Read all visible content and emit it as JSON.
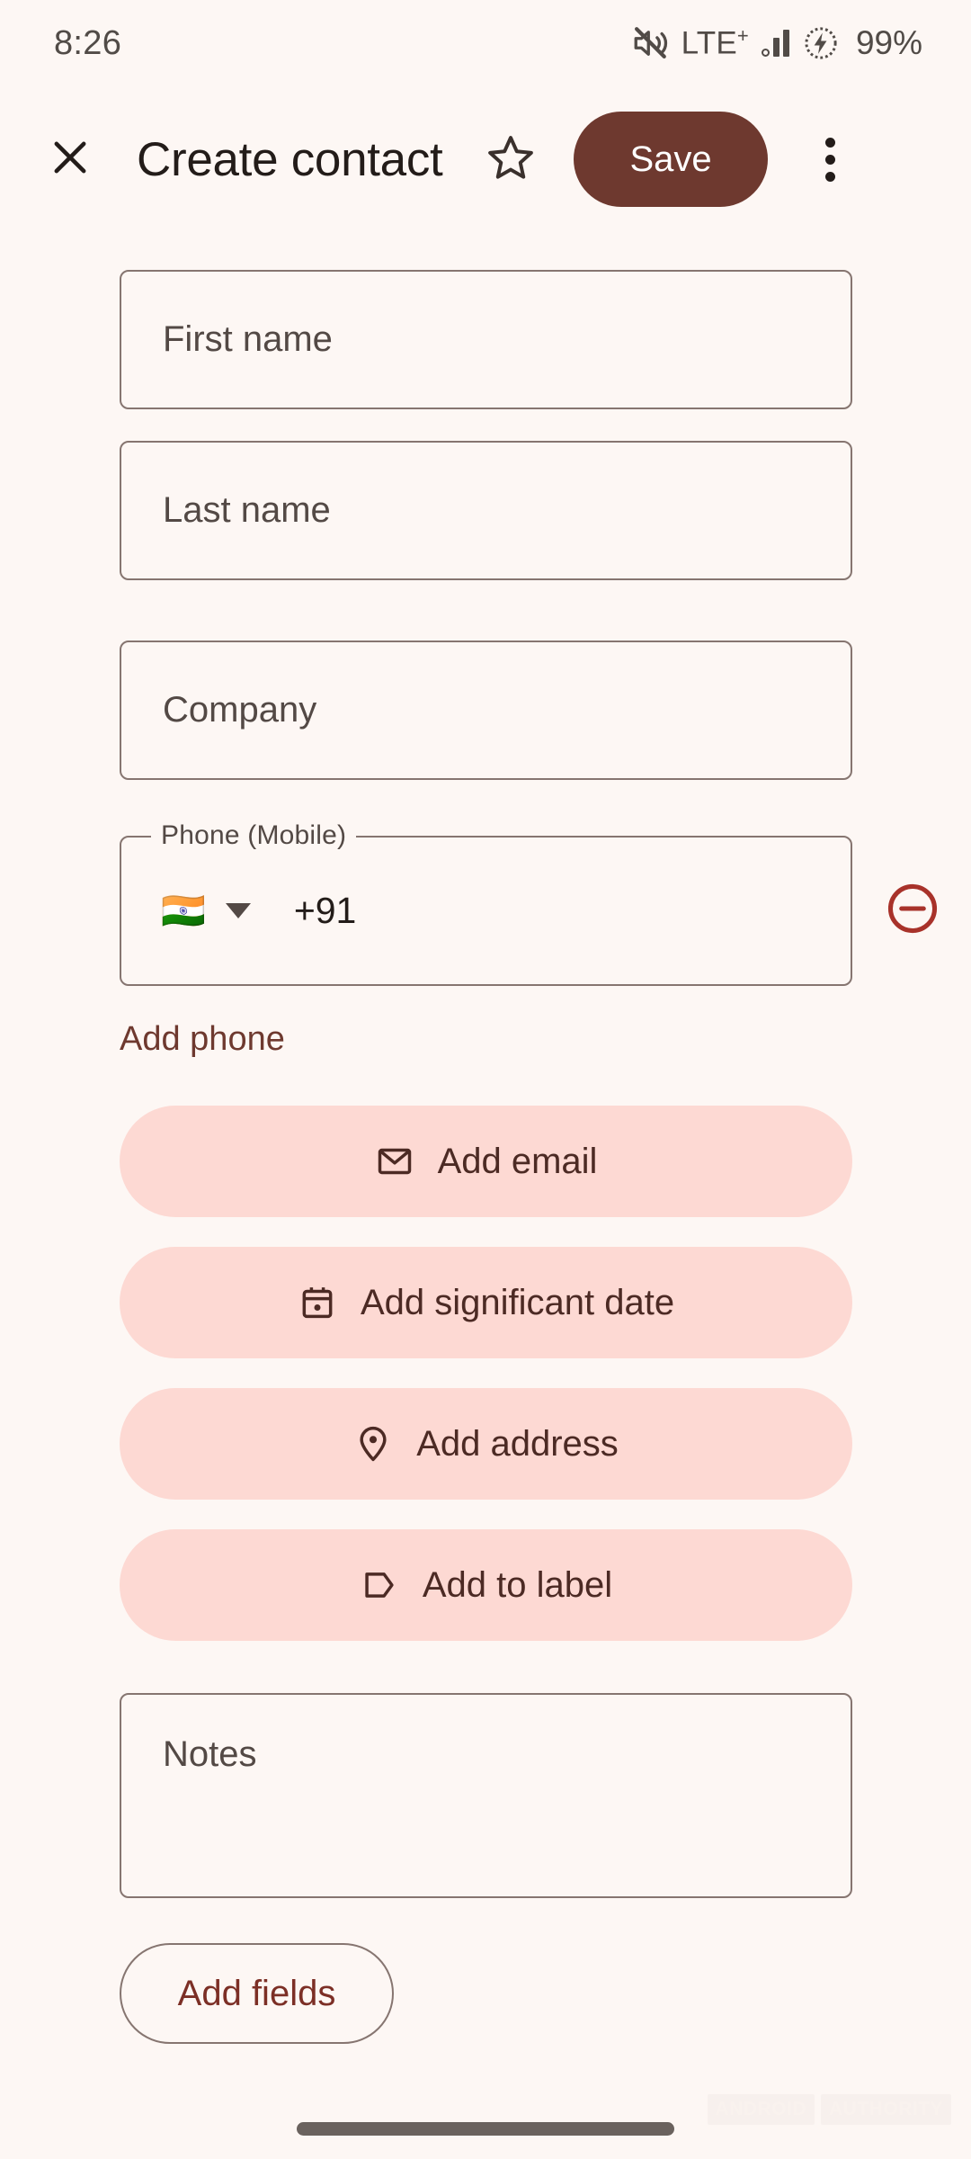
{
  "statusbar": {
    "time": "8:26",
    "mute_icon": "volume-off-icon",
    "network_label": "LTE",
    "network_sup": "+",
    "signal_icon": "signal-bars-icon",
    "battery_icon": "battery-charging-icon",
    "battery_percent": "99%"
  },
  "toolbar": {
    "close_icon": "close-icon",
    "title": "Create contact",
    "favorite_icon": "star-outline-icon",
    "save_label": "Save",
    "overflow_icon": "more-vert-icon"
  },
  "form": {
    "first_name": {
      "placeholder": "First name",
      "value": ""
    },
    "last_name": {
      "placeholder": "Last name",
      "value": ""
    },
    "company": {
      "placeholder": "Company",
      "value": ""
    },
    "phone": {
      "label": "Phone (Mobile)",
      "flag": "🇮🇳",
      "dial_code": "+91",
      "caret_icon": "chevron-down-icon",
      "remove_icon": "remove-circle-icon"
    },
    "add_phone_label": "Add phone",
    "notes": {
      "placeholder": "Notes",
      "value": ""
    }
  },
  "chips": [
    {
      "label": "Add email",
      "icon": "envelope-icon"
    },
    {
      "label": "Add significant date",
      "icon": "calendar-icon"
    },
    {
      "label": "Add address",
      "icon": "location-pin-icon"
    },
    {
      "label": "Add to label",
      "icon": "tag-icon"
    }
  ],
  "add_fields_label": "Add fields",
  "watermark": {
    "word1": "ANDROID",
    "word2": "AUTHORITY"
  },
  "colors": {
    "background": "#FDF7F4",
    "accent_dark": "#6E392F",
    "chip_bg": "#FDD9D3",
    "chip_text": "#4C2A24",
    "outline": "#867570",
    "remove_red": "#A8322A",
    "text_primary": "#231C19",
    "text_secondary": "#534945"
  }
}
